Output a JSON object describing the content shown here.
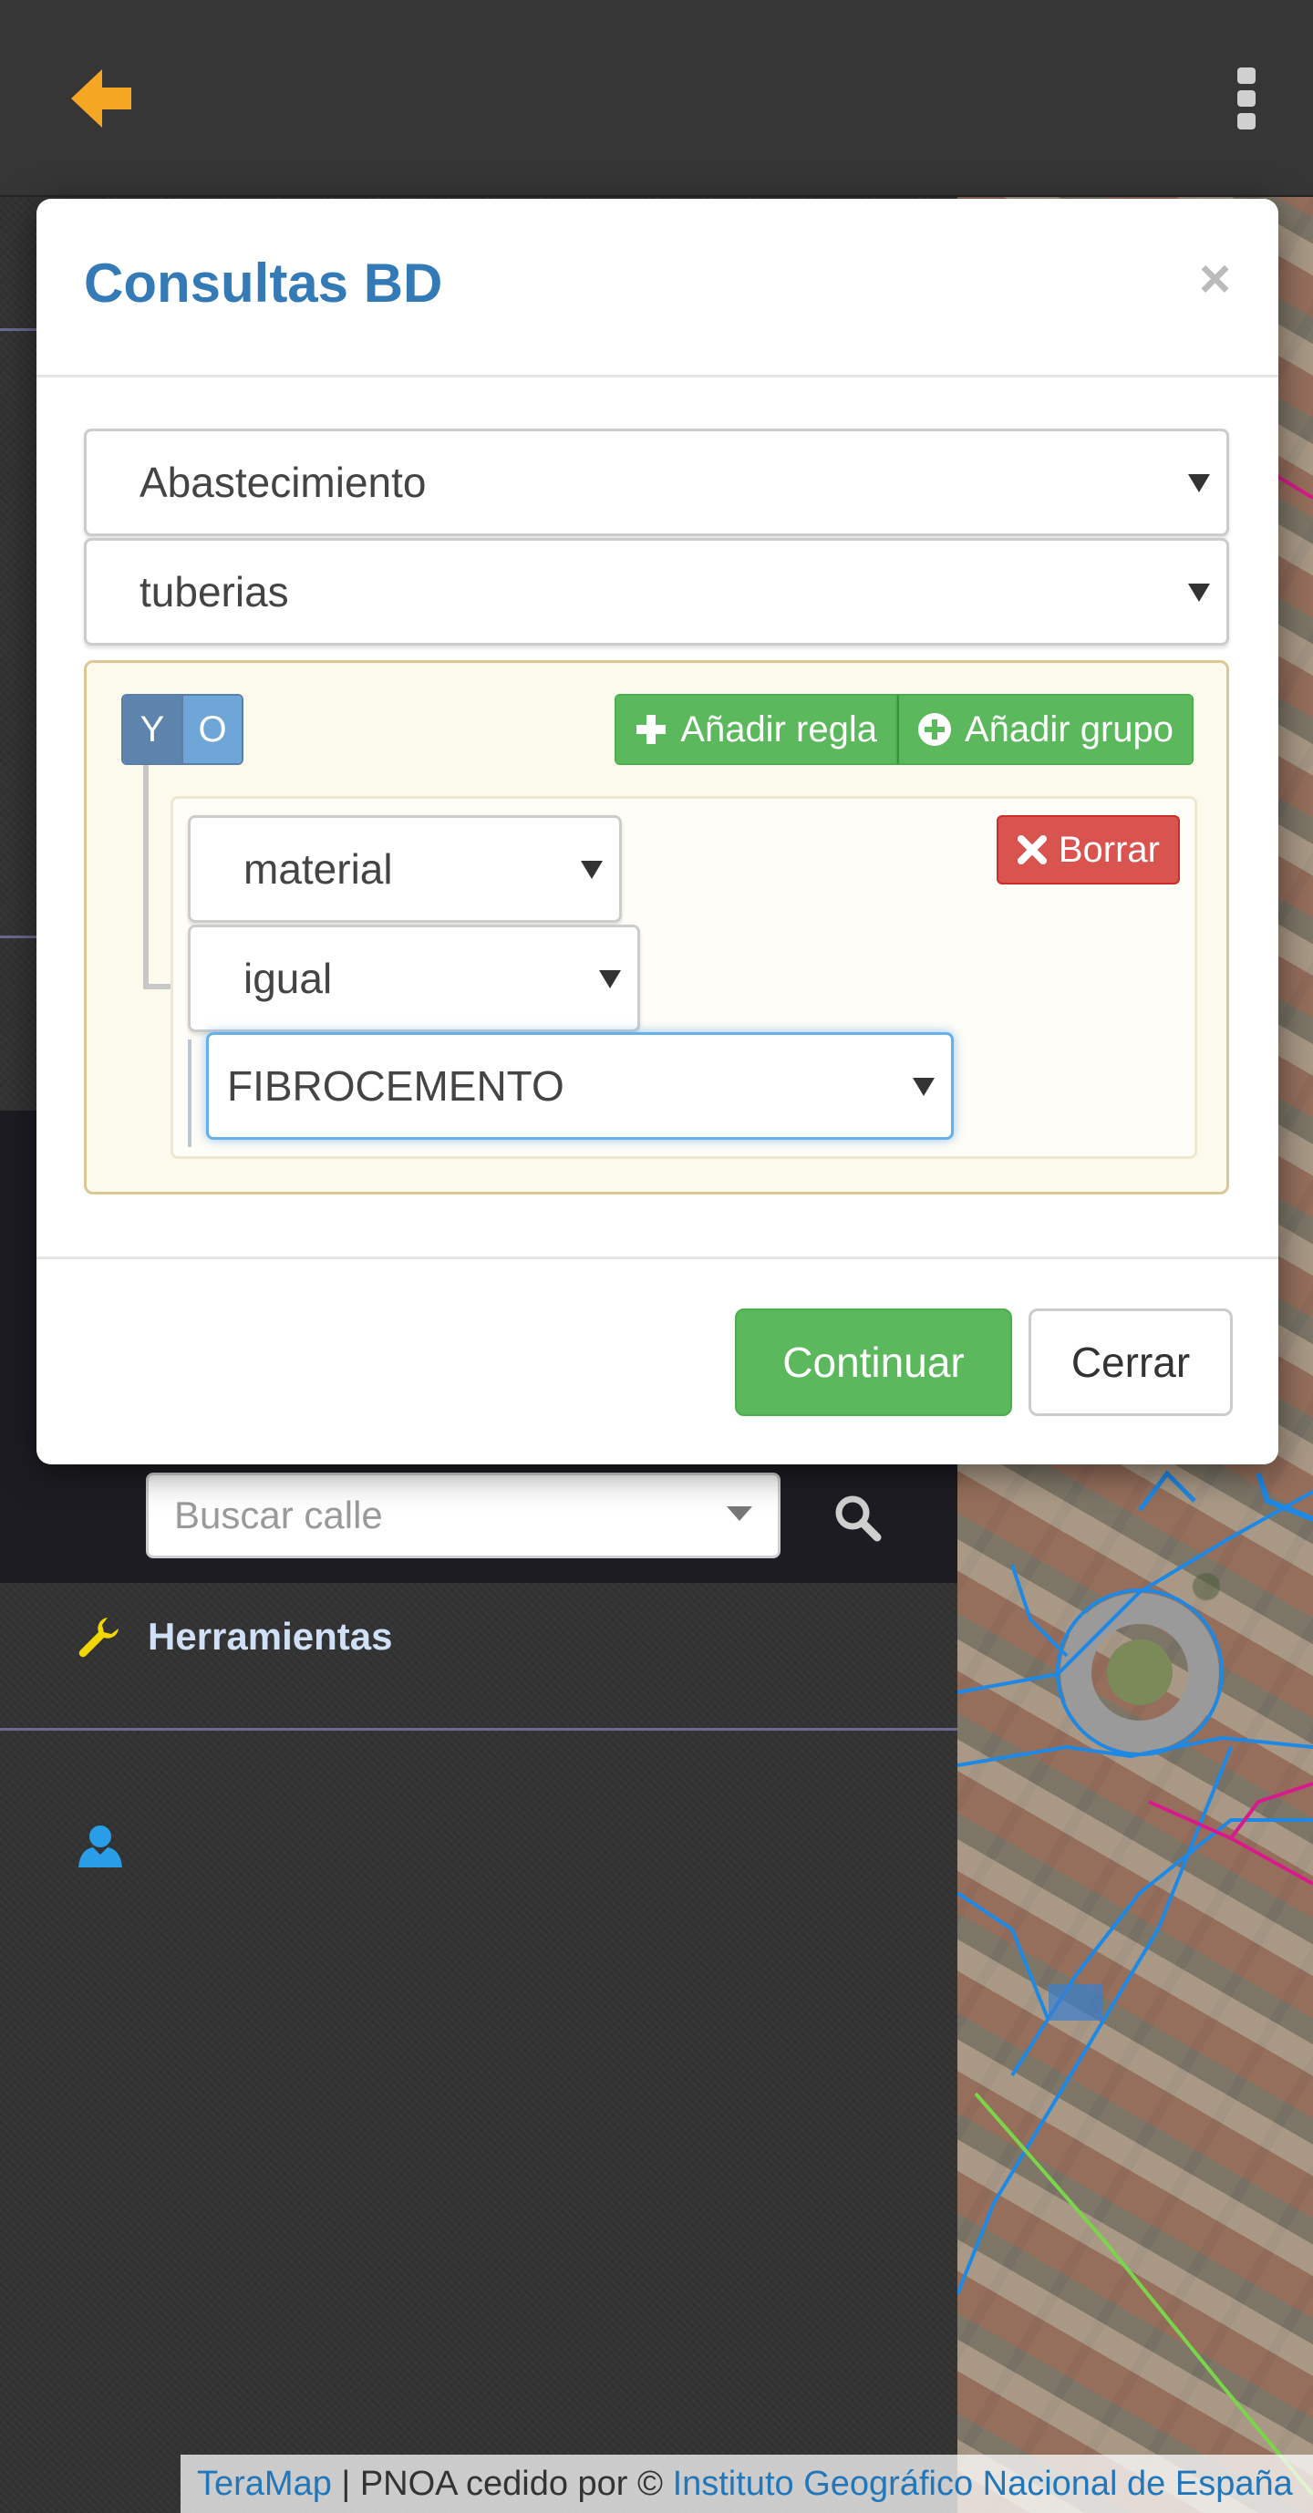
{
  "modal": {
    "title": "Consultas BD",
    "close_glyph": "×",
    "layer_select": "Abastecimiento",
    "table_select": "tuberias",
    "condition": {
      "and_label": "Y",
      "or_label": "O",
      "selected": "Y"
    },
    "add_rule_label": "Añadir regla",
    "add_group_label": "Añadir grupo",
    "rule": {
      "field": "material",
      "operator": "igual",
      "value": "FIBROCEMENTO",
      "delete_label": "Borrar"
    },
    "continue_label": "Continuar",
    "cancel_label": "Cerrar"
  },
  "sidebar": {
    "search_placeholder": "Buscar calle",
    "tools_label": "Herramientas"
  },
  "attribution": {
    "brand": "TeraMap",
    "separator": " | PNOA cedido por © ",
    "provider": "Instituto Geográfico Nacional de España"
  },
  "colors": {
    "accent": "#337ab7",
    "back_arrow": "#f5a623",
    "success": "#5cb85c",
    "danger": "#d9534f",
    "network_blue": "#1e88e5",
    "network_magenta": "#d81b8c",
    "network_green": "#7cd44a"
  }
}
